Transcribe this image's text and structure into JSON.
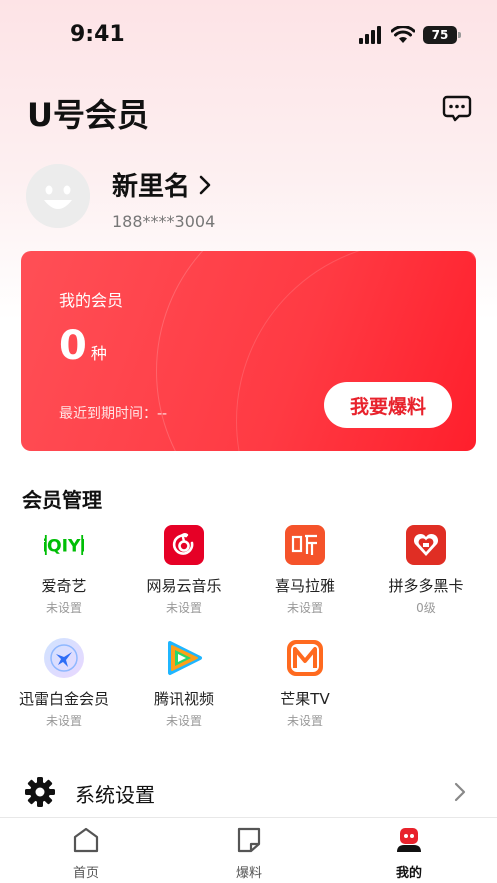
{
  "status_bar": {
    "time": "9:41",
    "battery": "75"
  },
  "header": {
    "title": "U号会员"
  },
  "profile": {
    "name": "新里名",
    "phone": "188****3004"
  },
  "member_card": {
    "label": "我的会员",
    "count": "0",
    "unit": "种",
    "expiry": "最近到期时间：--",
    "button": "我要爆料"
  },
  "membership": {
    "title": "会员管理",
    "items": [
      {
        "name": "爱奇艺",
        "status": "未设置",
        "icon": "iqiyi-icon"
      },
      {
        "name": "网易云音乐",
        "status": "未设置",
        "icon": "netease-music-icon"
      },
      {
        "name": "喜马拉雅",
        "status": "未设置",
        "icon": "ximalaya-icon"
      },
      {
        "name": "拼多多黑卡",
        "status": "0级",
        "icon": "pinduoduo-icon"
      },
      {
        "name": "迅雷白金会员",
        "status": "未设置",
        "icon": "xunlei-icon"
      },
      {
        "name": "腾讯视频",
        "status": "未设置",
        "icon": "tencent-video-icon"
      },
      {
        "name": "芒果TV",
        "status": "未设置",
        "icon": "mango-tv-icon"
      }
    ]
  },
  "settings": {
    "label": "系统设置"
  },
  "tabs": [
    {
      "label": "首页",
      "icon": "home-icon"
    },
    {
      "label": "爆料",
      "icon": "post-icon"
    },
    {
      "label": "我的",
      "icon": "profile-icon"
    }
  ],
  "colors": {
    "accent": "#ff3a43",
    "card_gradient_end": "#ff1f2c"
  }
}
